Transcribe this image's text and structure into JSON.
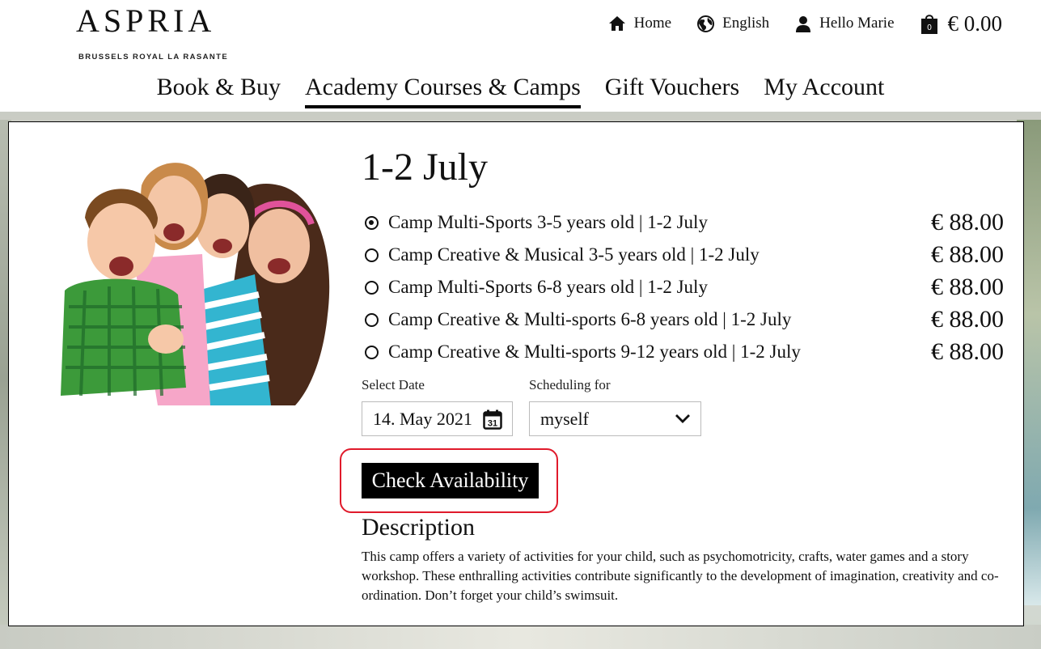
{
  "header": {
    "logo_main": "ASPRIA",
    "logo_sub": "BRUSSELS ROYAL LA RASANTE",
    "home_label": "Home",
    "language_label": "English",
    "user_label": "Hello Marie",
    "cart_count": "0",
    "cart_total": "€ 0.00"
  },
  "nav": {
    "items": [
      {
        "label": "Book & Buy"
      },
      {
        "label": "Academy Courses & Camps"
      },
      {
        "label": "Gift Vouchers"
      },
      {
        "label": "My Account"
      }
    ],
    "active": "Academy Courses & Camps"
  },
  "camp": {
    "title": "1-2 July",
    "options": [
      {
        "label": "Camp Multi-Sports 3-5 years old | 1-2 July",
        "price": "€ 88.00",
        "selected": true
      },
      {
        "label": "Camp Creative & Musical 3-5 years old | 1-2 July",
        "price": "€ 88.00",
        "selected": false
      },
      {
        "label": "Camp Multi-Sports 6-8 years old | 1-2 July",
        "price": "€ 88.00",
        "selected": false
      },
      {
        "label": "Camp Creative & Multi-sports 6-8 years old | 1-2 July",
        "price": "€ 88.00",
        "selected": false
      },
      {
        "label": "Camp Creative & Multi-sports 9-12 years old | 1-2 July",
        "price": "€ 88.00",
        "selected": false
      }
    ],
    "select_date_label": "Select Date",
    "date_value": "14. May 2021",
    "calendar_day": "31",
    "scheduling_label": "Scheduling for",
    "scheduling_value": "myself",
    "check_button": "Check Availability",
    "description_title": "Description",
    "description_text": "This camp offers a variety of activities for your child, such as psychomotricity, crafts, water games and a story workshop. These enthralling activities contribute significantly to the development of imagination, creativity and co-ordination. Don’t forget your child’s swimsuit."
  },
  "colors": {
    "highlight": "#e01a2b",
    "button_bg": "#000000"
  }
}
